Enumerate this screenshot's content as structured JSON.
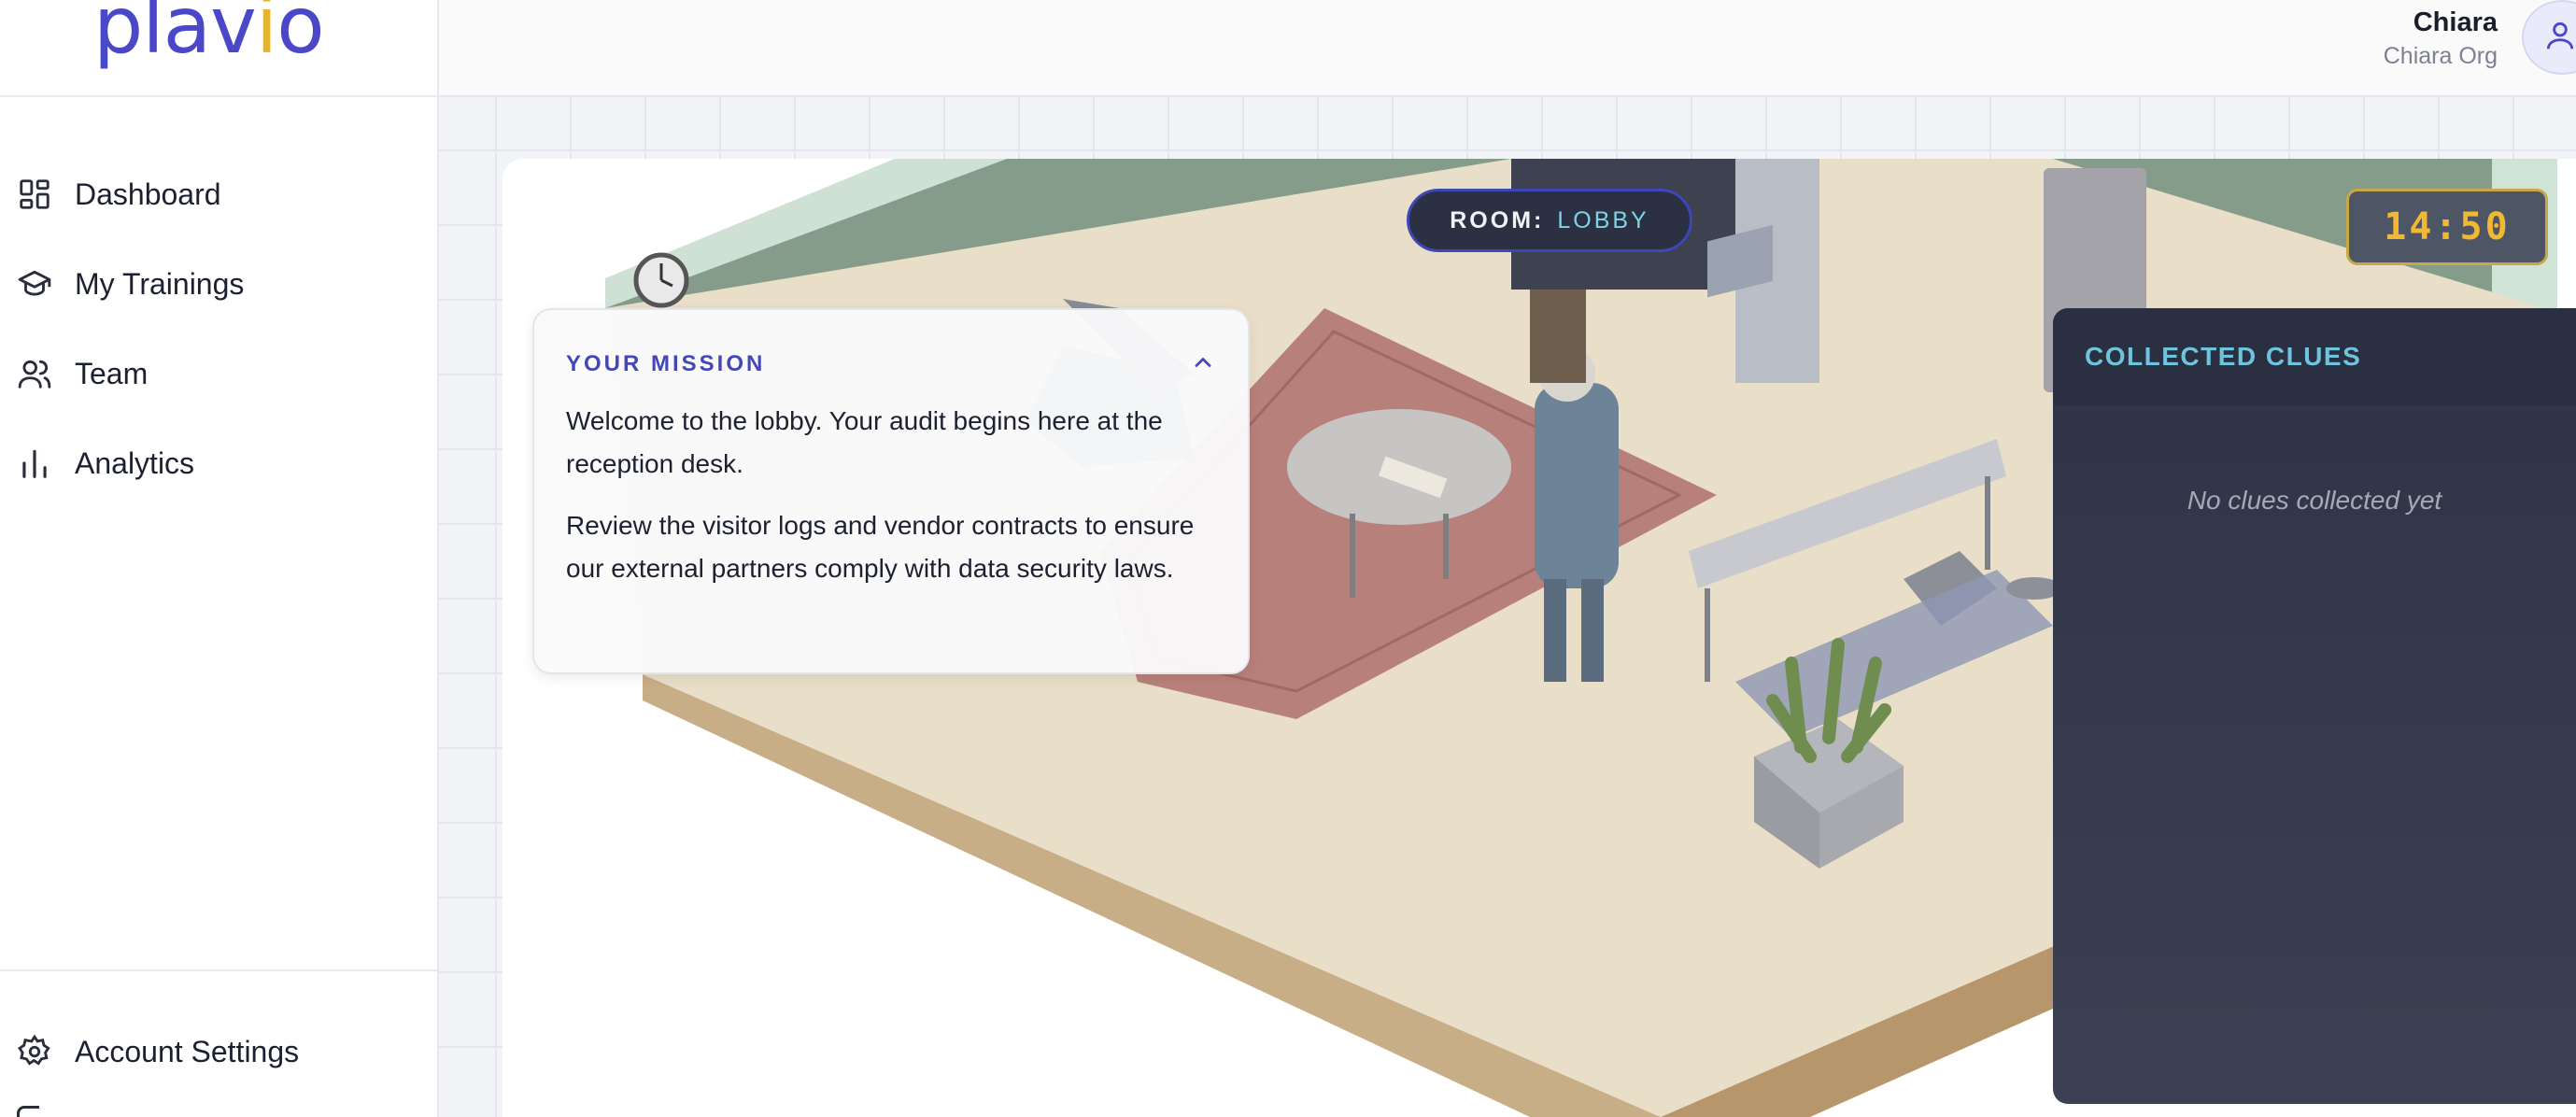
{
  "brand": {
    "logo_pre": "plav",
    "logo_accent": "i",
    "logo_post": "o"
  },
  "sidebar": {
    "items": [
      {
        "label": "Dashboard",
        "icon": "dashboard-grid-icon"
      },
      {
        "label": "My Trainings",
        "icon": "graduation-cap-icon"
      },
      {
        "label": "Team",
        "icon": "users-icon"
      },
      {
        "label": "Analytics",
        "icon": "bar-chart-icon"
      }
    ],
    "bottom": {
      "label": "Account Settings",
      "icon": "gear-icon"
    }
  },
  "header": {
    "user_name": "Chiara",
    "user_org": "Chiara Org",
    "avatar_icon": "user-icon"
  },
  "game": {
    "room_label": "ROOM:",
    "room_value": "LOBBY",
    "timer": "14:50",
    "mission": {
      "title": "YOUR MISSION",
      "paragraphs": [
        "Welcome to the lobby. Your audit begins here at the reception desk.",
        "Review the visitor logs and vendor contracts to ensure our external partners comply with data security laws."
      ]
    },
    "clues": {
      "title": "COLLECTED CLUES",
      "empty_text": "No clues collected yet"
    }
  },
  "colors": {
    "brand": "#4a47c9",
    "brand_accent": "#e9b22c",
    "timer_text": "#f1b931",
    "clue_heading": "#6fc4dd",
    "wall": "#869c8a",
    "floor": "#e8dfcb",
    "rug": "#b97f7a"
  }
}
